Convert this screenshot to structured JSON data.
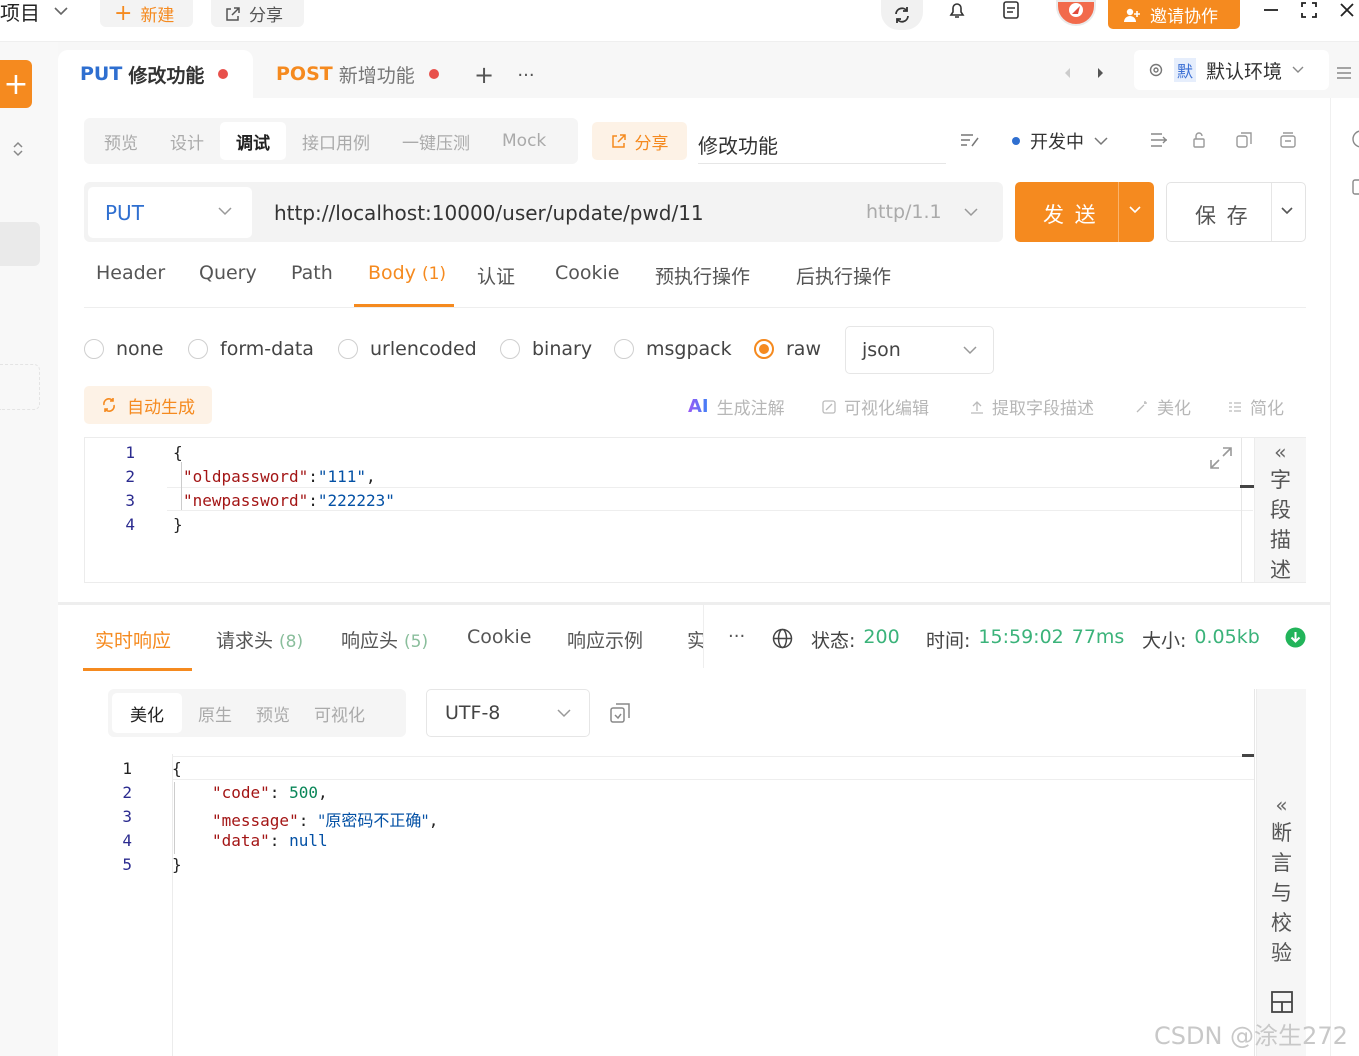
{
  "topbar": {
    "project_label": "项目",
    "new_label": "新建",
    "share_label": "分享",
    "invite_label": "邀请协作"
  },
  "tabs": [
    {
      "method": "PUT",
      "name": "修改功能"
    },
    {
      "method": "POST",
      "name": "新增功能"
    }
  ],
  "environment": {
    "badge": "默",
    "name": "默认环境"
  },
  "mode_tabs": [
    "预览",
    "设计",
    "调试",
    "接口用例",
    "一键压测",
    "Mock"
  ],
  "active_mode": "调试",
  "share_btn": "分享",
  "api_name": "修改功能",
  "status": "开发中",
  "request": {
    "method": "PUT",
    "url": "http://localhost:10000/user/update/pwd/11",
    "protocol": "http/1.1",
    "send_label": "发 送",
    "save_label": "保 存"
  },
  "param_tabs": {
    "header": "Header",
    "query": "Query",
    "path": "Path",
    "body": "Body",
    "body_count": "(1)",
    "auth": "认证",
    "cookie": "Cookie",
    "pre": "预执行操作",
    "post": "后执行操作"
  },
  "body_types": [
    "none",
    "form-data",
    "urlencoded",
    "binary",
    "msgpack",
    "raw"
  ],
  "body_type_selected": "raw",
  "raw_format": "json",
  "auto_gen": "自动生成",
  "editor_tools": {
    "ai_badge": "AI",
    "comment": "生成注解",
    "visual": "可视化编辑",
    "extract": "提取字段描述",
    "beautify": "美化",
    "simplify": "简化"
  },
  "request_body": {
    "line_numbers": [
      "1",
      "2",
      "3",
      "4"
    ],
    "open": "{",
    "k1": "\"oldpassword\"",
    "v1": "\"111\"",
    "k2": "\"newpassword\"",
    "v2": "\"222223\"",
    "close": "}"
  },
  "field_desc_label": [
    "字",
    "段",
    "描",
    "述"
  ],
  "response_tabs": {
    "realtime": "实时响应",
    "req_headers": "请求头",
    "req_headers_count": "(8)",
    "resp_headers": "响应头",
    "resp_headers_count": "(5)",
    "cookie": "Cookie",
    "example": "响应示例",
    "more": "实"
  },
  "response_meta": {
    "status_label": "状态:",
    "status": "200",
    "time_label": "时间:",
    "time": "15:59:02",
    "duration": "77ms",
    "size_label": "大小:",
    "size": "0.05kb"
  },
  "view_modes": [
    "美化",
    "原生",
    "预览",
    "可视化"
  ],
  "active_view": "美化",
  "encoding": "UTF-8",
  "response_body": {
    "line_numbers": [
      "1",
      "2",
      "3",
      "4",
      "5"
    ],
    "open": "{",
    "k1": "\"code\"",
    "v1": "500",
    "k2": "\"message\"",
    "v2": "\"原密码不正确\"",
    "k3": "\"data\"",
    "v3": "null",
    "close": "}"
  },
  "assert_label": [
    "断",
    "言",
    "与",
    "校",
    "验"
  ],
  "watermark": "CSDN @涂生272",
  "colors": {
    "accent": "#f58a1f",
    "success": "#3bb37a",
    "dirty_dot": "#e8504b"
  }
}
